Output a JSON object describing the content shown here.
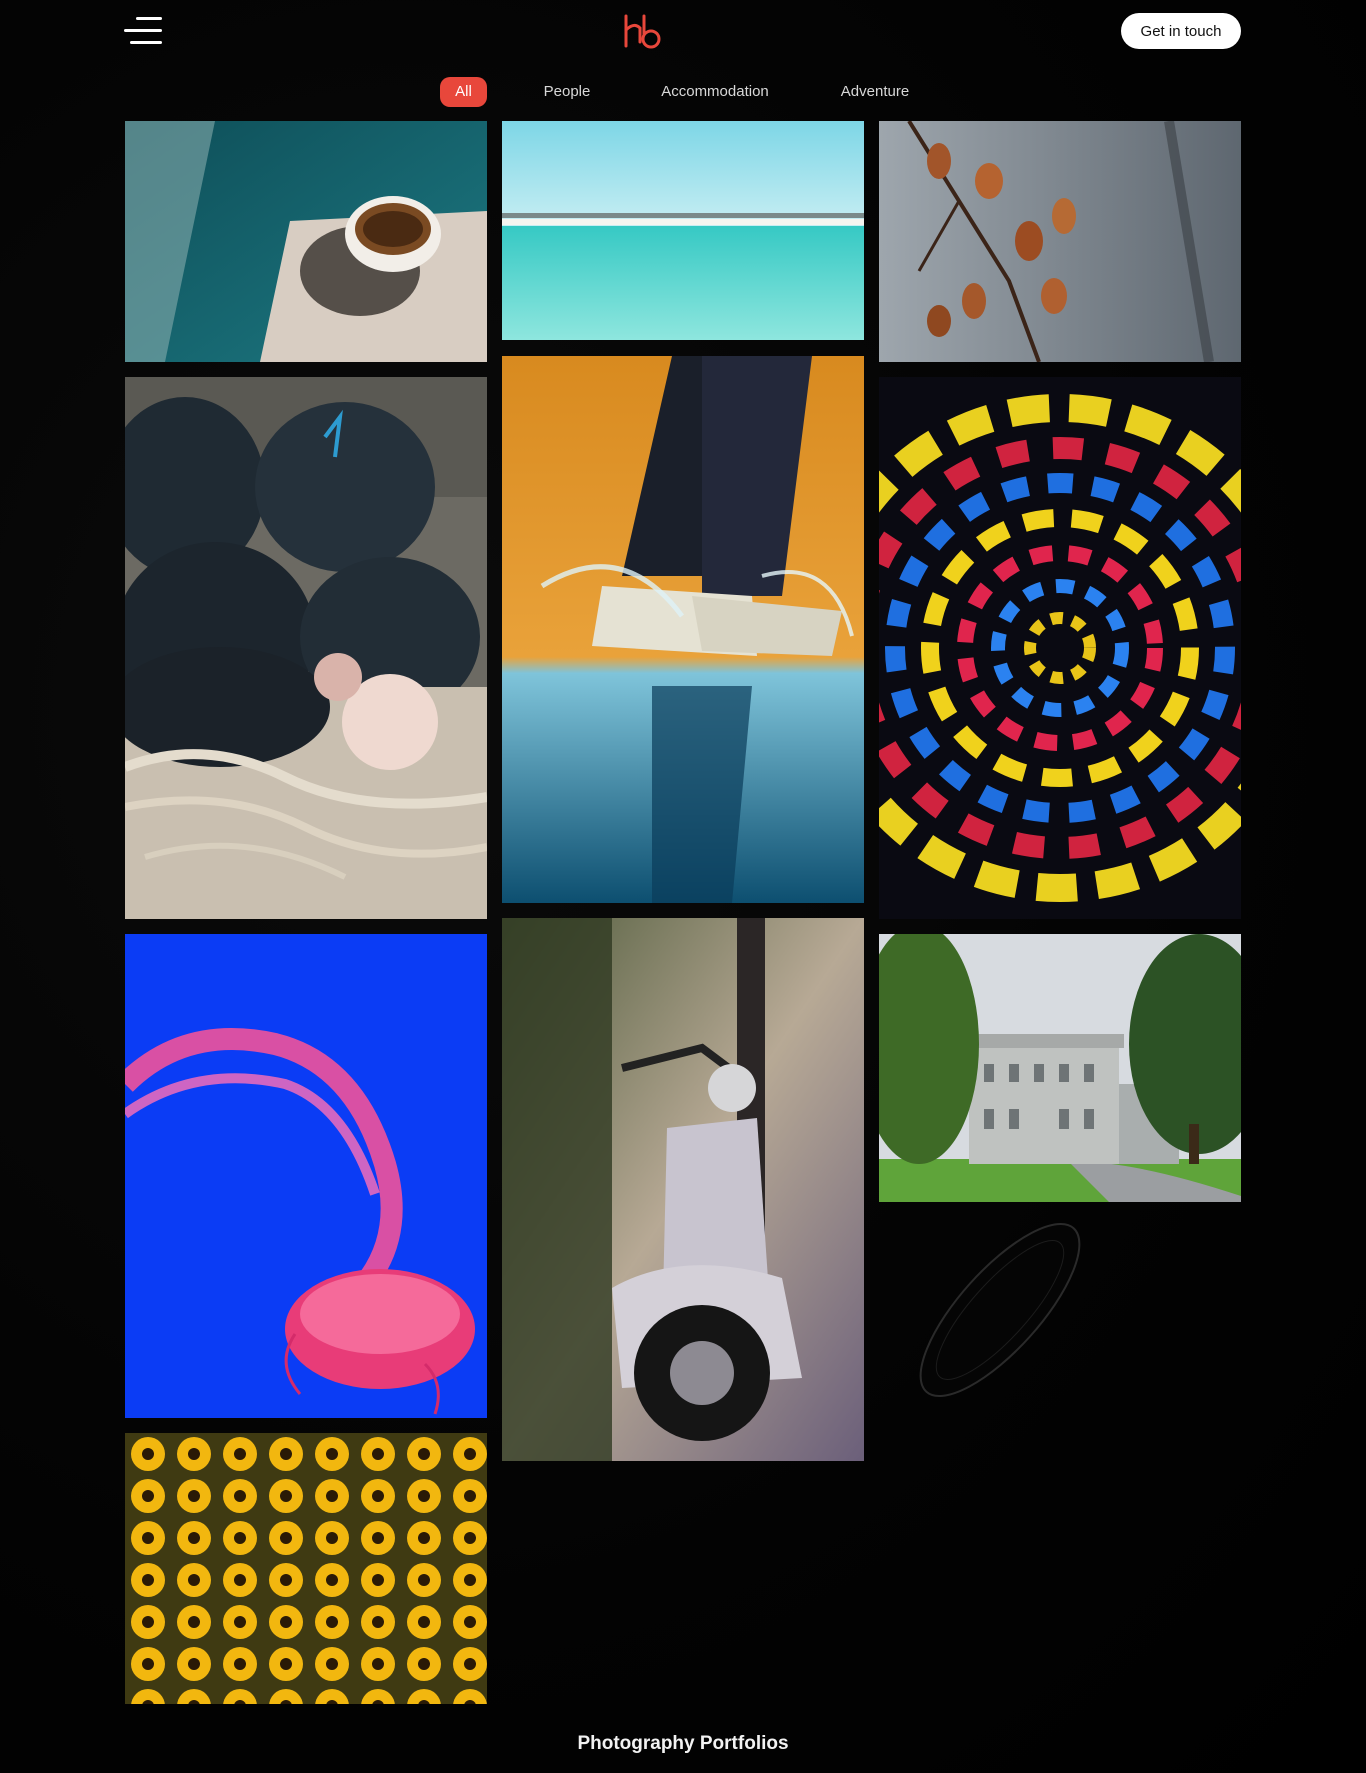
{
  "header": {
    "cta_label": "Get in touch"
  },
  "filters": [
    {
      "label": "All",
      "active": true
    },
    {
      "label": "People",
      "active": false
    },
    {
      "label": "Accommodation",
      "active": false
    },
    {
      "label": "Adventure",
      "active": false
    }
  ],
  "gallery": [
    {
      "subject": "coffee cup on ledge by water"
    },
    {
      "subject": "turquoise sea with overwater villas"
    },
    {
      "subject": "autumn leaves on branch"
    },
    {
      "subject": "fishing nets and ropes on sand"
    },
    {
      "subject": "sneakers splashing in water"
    },
    {
      "subject": "colorful spinning light swirl"
    },
    {
      "subject": "pink jellyfish on blue"
    },
    {
      "subject": "vintage scooter on street"
    },
    {
      "subject": "stately manor house with trees"
    },
    {
      "subject": "yellow black-eyed susan flowers"
    }
  ],
  "footer": {
    "title": "Photography Portfolios"
  },
  "colors": {
    "background": "#030303",
    "accent": "#e8473b",
    "cta_bg": "#ffffff"
  },
  "icons": {
    "menu": "hamburger-menu-icon",
    "logo": "brand-logo"
  }
}
